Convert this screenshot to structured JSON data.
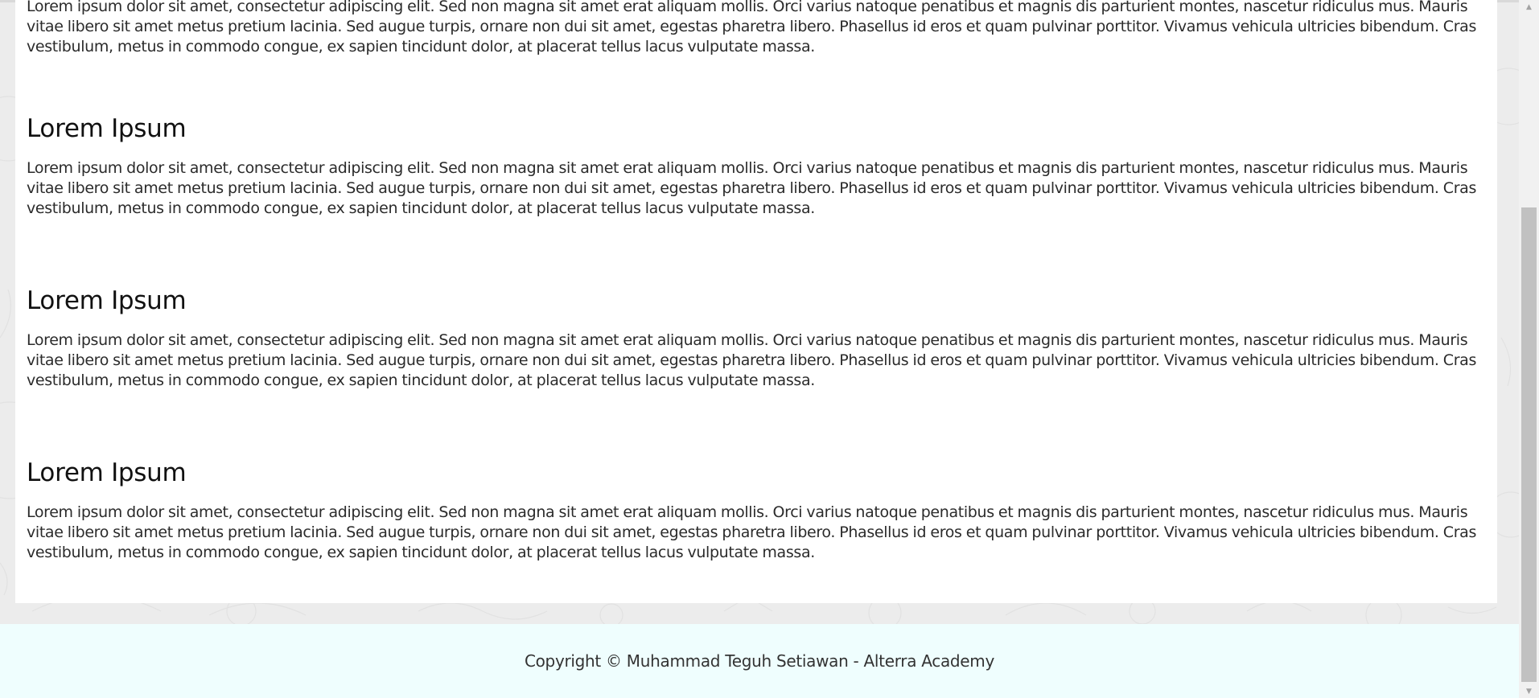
{
  "sections": [
    {
      "heading": "",
      "body": "Lorem ipsum dolor sit amet, consectetur adipiscing elit. Sed non magna sit amet erat aliquam mollis. Orci varius natoque penatibus et magnis dis parturient montes, nascetur ridiculus mus. Mauris vitae libero sit amet metus pretium lacinia. Sed augue turpis, ornare non dui sit amet, egestas pharetra libero. Phasellus id eros et quam pulvinar porttitor. Vivamus vehicula ultricies bibendum. Cras vestibulum, metus in commodo congue, ex sapien tincidunt dolor, at placerat tellus lacus vulputate massa."
    },
    {
      "heading": "Lorem Ipsum",
      "body": "Lorem ipsum dolor sit amet, consectetur adipiscing elit. Sed non magna sit amet erat aliquam mollis. Orci varius natoque penatibus et magnis dis parturient montes, nascetur ridiculus mus. Mauris vitae libero sit amet metus pretium lacinia. Sed augue turpis, ornare non dui sit amet, egestas pharetra libero. Phasellus id eros et quam pulvinar porttitor. Vivamus vehicula ultricies bibendum. Cras vestibulum, metus in commodo congue, ex sapien tincidunt dolor, at placerat tellus lacus vulputate massa."
    },
    {
      "heading": "Lorem Ipsum",
      "body": "Lorem ipsum dolor sit amet, consectetur adipiscing elit. Sed non magna sit amet erat aliquam mollis. Orci varius natoque penatibus et magnis dis parturient montes, nascetur ridiculus mus. Mauris vitae libero sit amet metus pretium lacinia. Sed augue turpis, ornare non dui sit amet, egestas pharetra libero. Phasellus id eros et quam pulvinar porttitor. Vivamus vehicula ultricies bibendum. Cras vestibulum, metus in commodo congue, ex sapien tincidunt dolor, at placerat tellus lacus vulputate massa."
    },
    {
      "heading": "Lorem Ipsum",
      "body": "Lorem ipsum dolor sit amet, consectetur adipiscing elit. Sed non magna sit amet erat aliquam mollis. Orci varius natoque penatibus et magnis dis parturient montes, nascetur ridiculus mus. Mauris vitae libero sit amet metus pretium lacinia. Sed augue turpis, ornare non dui sit amet, egestas pharetra libero. Phasellus id eros et quam pulvinar porttitor. Vivamus vehicula ultricies bibendum. Cras vestibulum, metus in commodo congue, ex sapien tincidunt dolor, at placerat tellus lacus vulputate massa."
    }
  ],
  "footer": {
    "copyright": "Copyright © Muhammad Teguh Setiawan - Alterra Academy"
  },
  "scrollbar": {
    "up_icon": "triangle-up-icon",
    "down_icon": "triangle-down-icon"
  },
  "colors": {
    "page_background": "#ececec",
    "card_background": "#ffffff",
    "footer_background": "#effefe",
    "text": "#2b2b2b",
    "heading": "#111111"
  }
}
